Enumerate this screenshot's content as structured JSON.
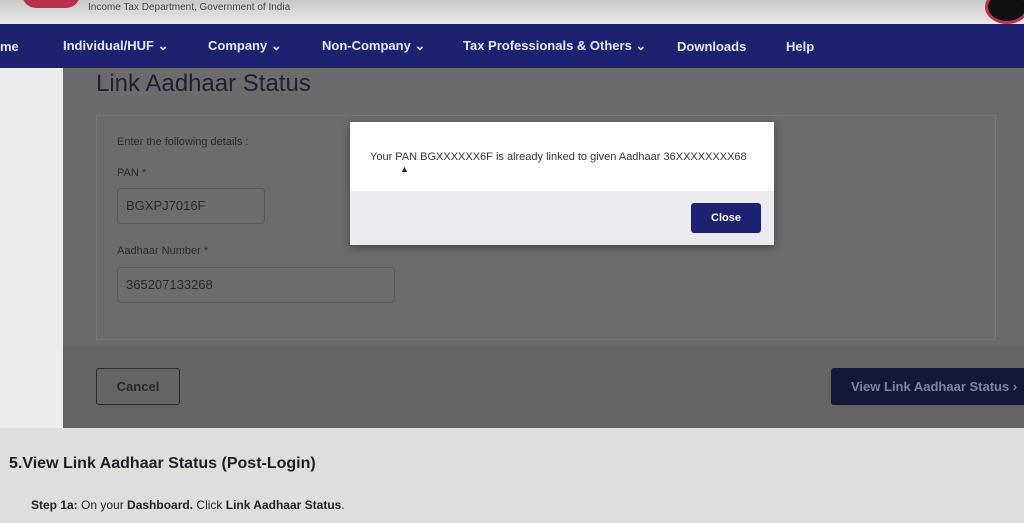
{
  "header": {
    "dept": "Income Tax Department, Government of India"
  },
  "nav": {
    "items": [
      "me",
      "Individual/HUF ⌄",
      "Company ⌄",
      "Non-Company ⌄",
      "Tax Professionals & Others ⌄",
      "Downloads",
      "Help"
    ]
  },
  "form": {
    "title": "Link Aadhaar Status",
    "instructions": "Enter the following details :",
    "pan_label": "PAN  *",
    "pan_value": "BGXPJ7016F",
    "aadhaar_label": "Aadhaar Number  *",
    "aadhaar_value": "365207133268",
    "cancel": "Cancel",
    "view": "View Link Aadhaar Status  ›"
  },
  "modal": {
    "message": "Your PAN BGXXXXXX6F is already linked to given Aadhaar 36XXXXXXXX68",
    "close": "Close"
  },
  "article": {
    "heading": "5.View Link Aadhaar Status (Post-Login)",
    "step_prefix": "Step 1a:",
    "step_text1": " On your ",
    "step_bold1": "Dashboard.",
    "step_text2": " Click ",
    "step_bold2": "Link Aadhaar Status",
    "step_end": "."
  }
}
